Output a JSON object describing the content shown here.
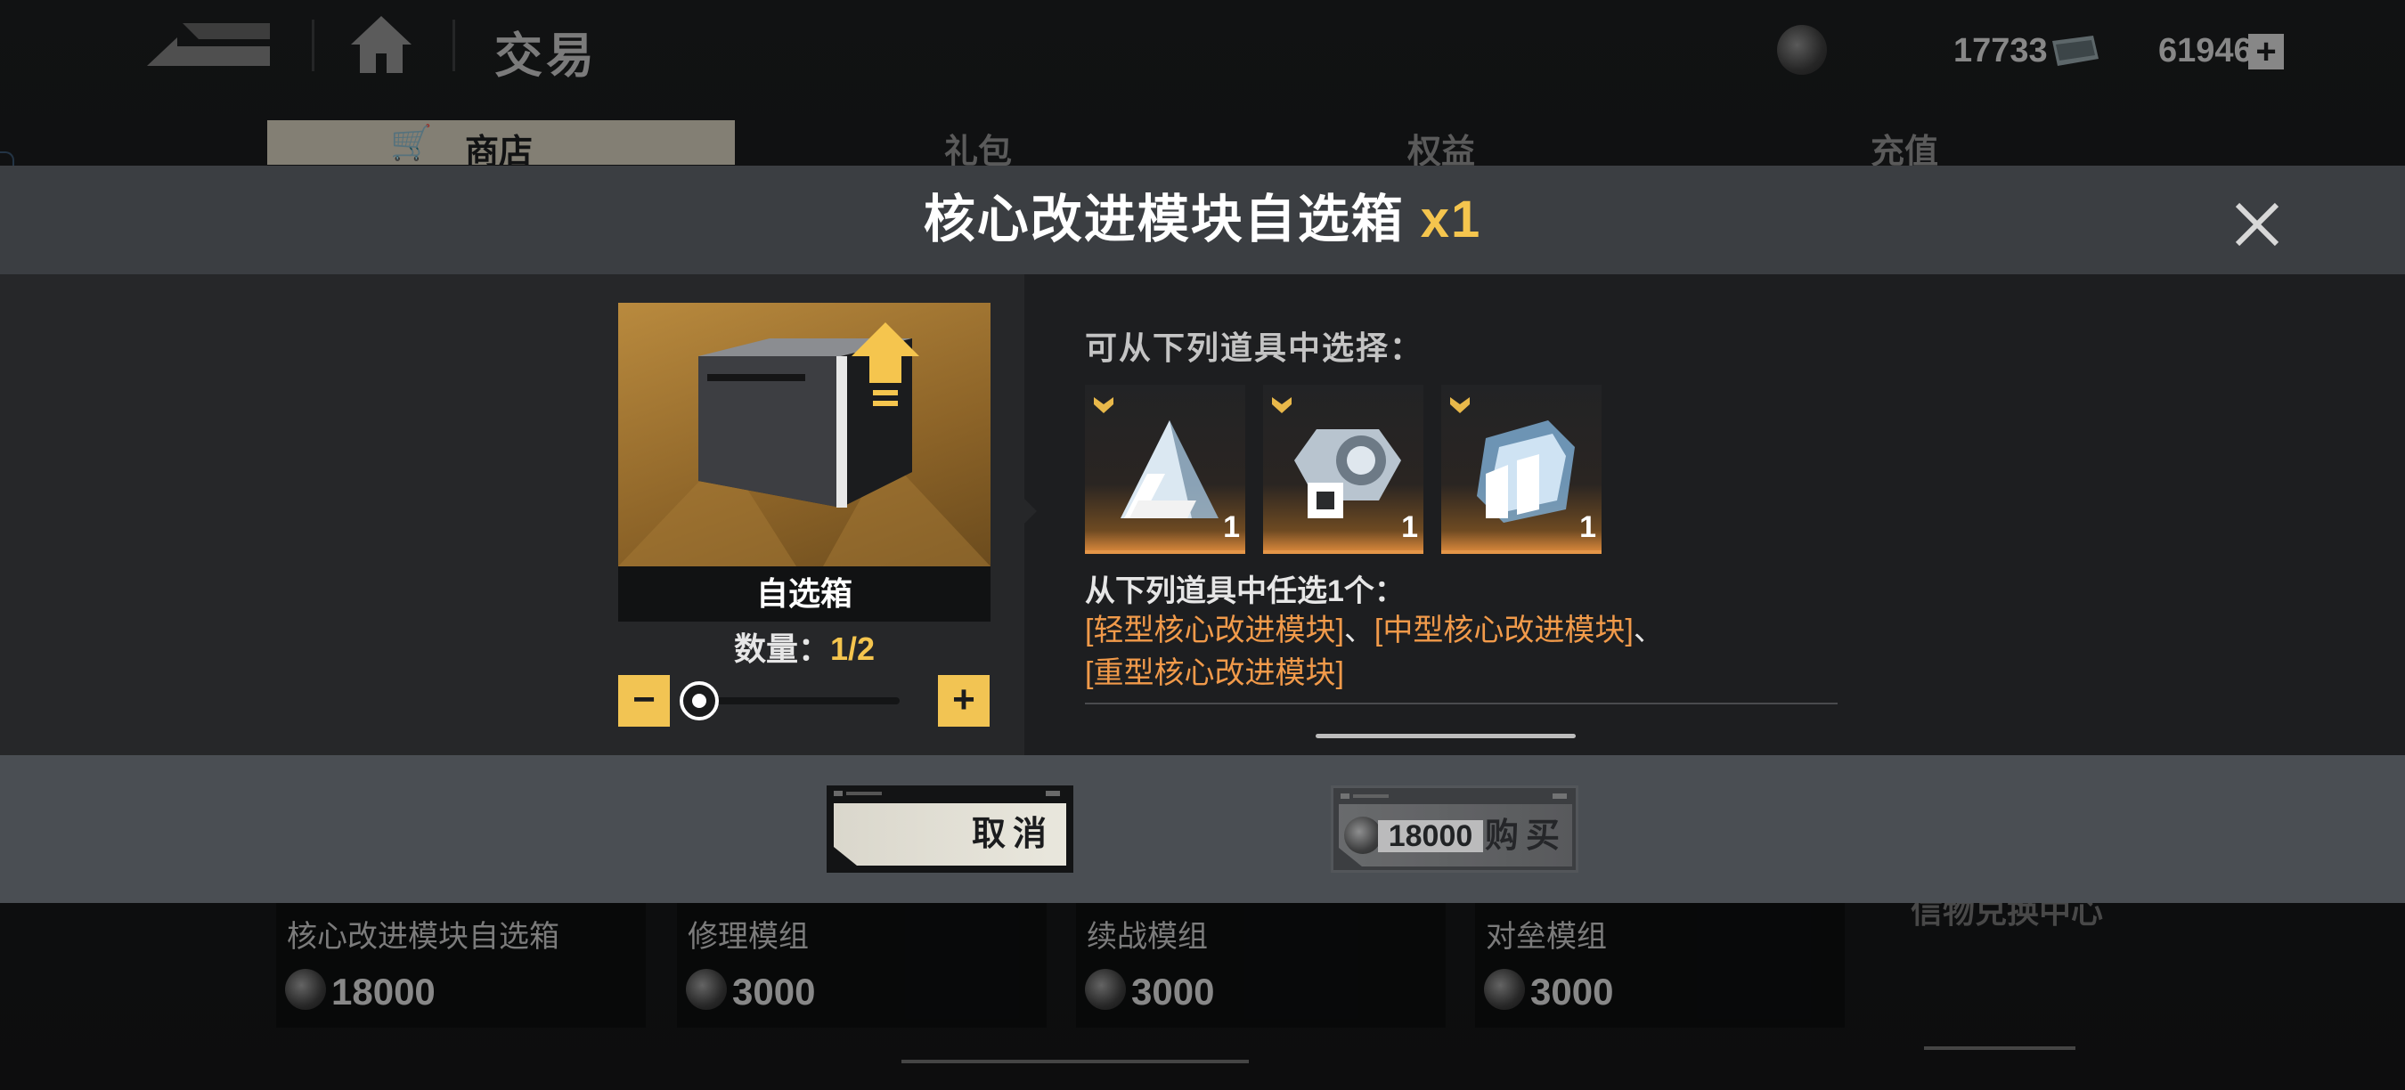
{
  "header": {
    "title": "交易",
    "currency_a": "17733",
    "currency_b": "619460",
    "tabs": [
      {
        "label": "商店",
        "active": true
      },
      {
        "label": "礼包"
      },
      {
        "label": "权益"
      },
      {
        "label": "充值"
      }
    ]
  },
  "shop_items": [
    {
      "name": "核心改进模块自选箱",
      "price": "18000"
    },
    {
      "name": "修理模组",
      "price": "3000"
    },
    {
      "name": "续战模组",
      "price": "3000"
    },
    {
      "name": "对垒模组",
      "price": "3000"
    }
  ],
  "side_panel_title": "信物兑换中心",
  "modal": {
    "title": "核心改进模块自选箱",
    "title_qty": "x1",
    "item_label": "自选箱",
    "quantity_label": "数量：",
    "quantity_value": "1/2",
    "minus_label": "−",
    "plus_label": "+",
    "choose_heading": "可从下列道具中选择：",
    "choices": [
      {
        "icon": "light-core-module-icon",
        "count": "1"
      },
      {
        "icon": "medium-core-module-icon",
        "count": "1"
      },
      {
        "icon": "heavy-core-module-icon",
        "count": "1"
      }
    ],
    "rule_text": "从下列道具中任选1个：",
    "option_1": "[轻型核心改进模块]",
    "sep_1": "、",
    "option_2": "[中型核心改进模块]",
    "sep_2": "、",
    "option_3": "[重型核心改进模块]",
    "cancel_label": "取消",
    "buy_price": "18000",
    "buy_label": "购买"
  },
  "colors": {
    "accent_gold": "#f5c54e",
    "option_orange": "#f19a4a",
    "header_bar": "#3b3e42",
    "footer_bar": "#4a4e53"
  }
}
